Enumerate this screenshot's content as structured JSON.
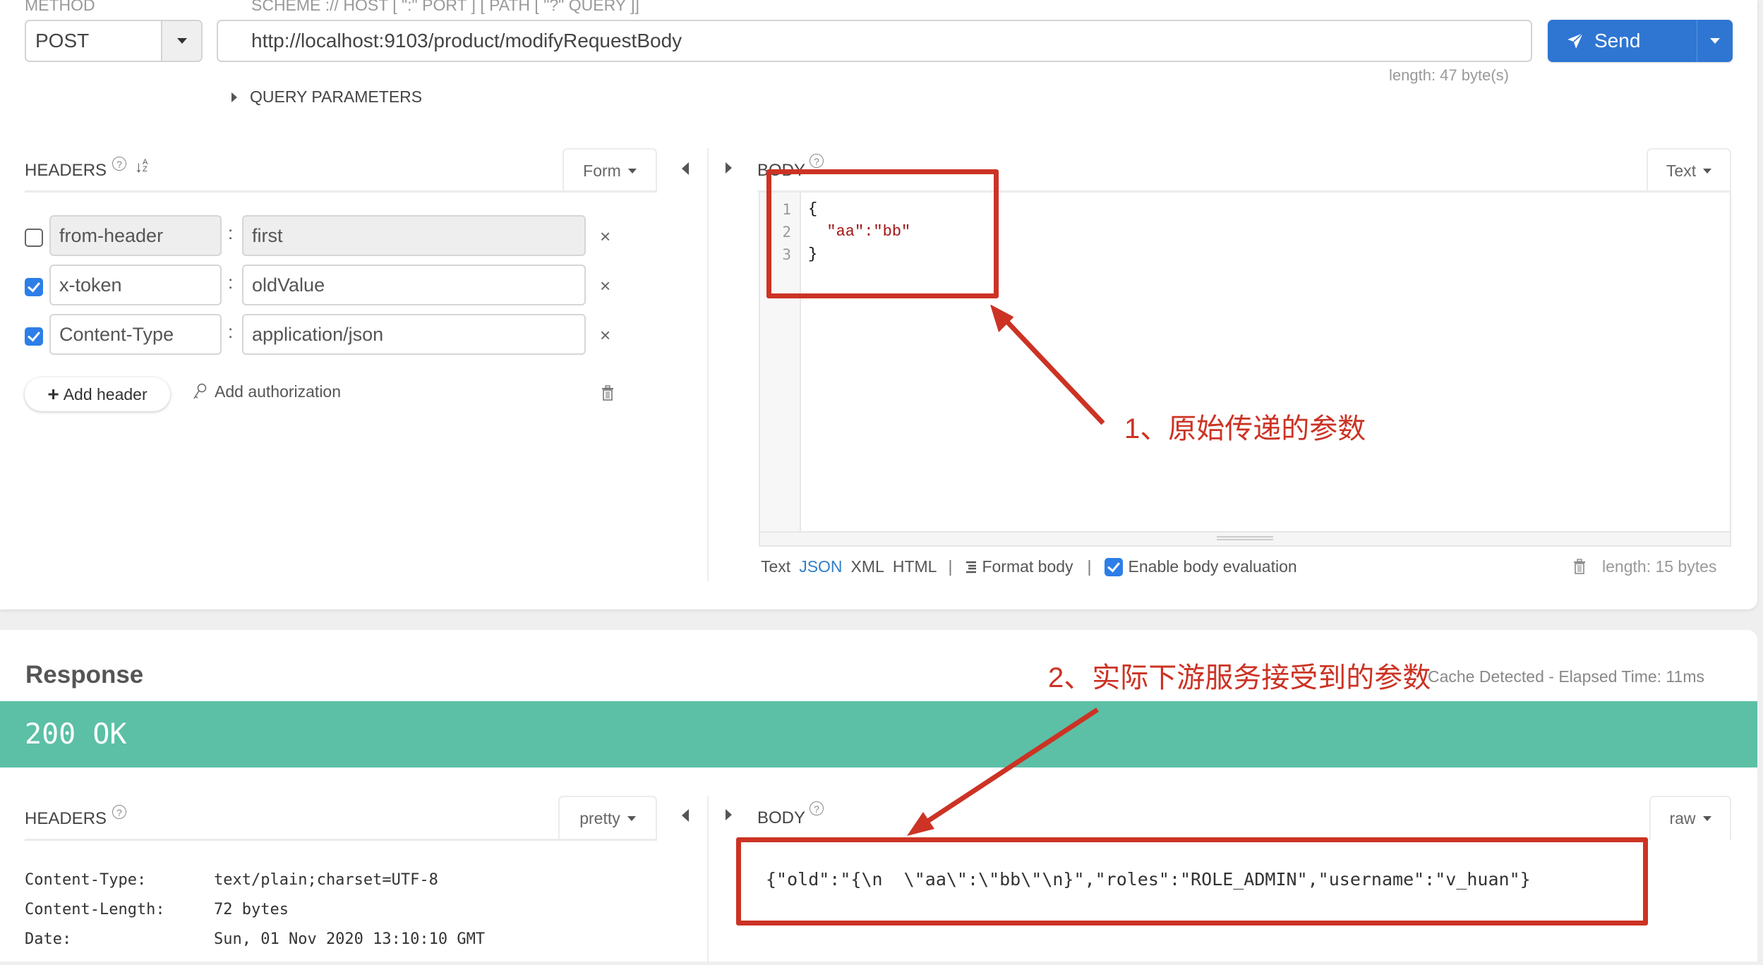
{
  "request": {
    "method_label": "METHOD",
    "method_value": "POST",
    "url_label": "SCHEME :// HOST [ \":\" PORT ] [ PATH [ \"?\" QUERY ]]",
    "url_value": "http://localhost:9103/product/modifyRequestBody",
    "url_length": "length: 47 byte(s)",
    "send_label": "Send",
    "query_params_label": "QUERY PARAMETERS",
    "headers": {
      "title": "HEADERS",
      "help": "?",
      "sort_icon": "sort-az-icon",
      "mode": "Form",
      "rows": [
        {
          "enabled": false,
          "key": "from-header",
          "value": "first"
        },
        {
          "enabled": true,
          "key": "x-token",
          "value": "oldValue"
        },
        {
          "enabled": true,
          "key": "Content-Type",
          "value": "application/json"
        }
      ],
      "separator": ":",
      "remove_icon": "×",
      "add_header_label": "Add header",
      "add_authorization_label": "Add authorization"
    },
    "body": {
      "title": "BODY",
      "help": "?",
      "mode": "Text",
      "lines": [
        {
          "num": "1",
          "text": "{"
        },
        {
          "num": "2",
          "text": "  \"aa\":\"bb\""
        },
        {
          "num": "3",
          "text": "}"
        }
      ],
      "formats": [
        "Text",
        "JSON",
        "XML",
        "HTML"
      ],
      "active_format": "JSON",
      "separator": "|",
      "format_body_label": "Format body",
      "enable_eval_label": "Enable body evaluation",
      "enable_eval_checked": true,
      "length": "length: 15 bytes"
    }
  },
  "response": {
    "title": "Response",
    "timing": "Cache Detected - Elapsed Time: 11ms",
    "status": "200 OK",
    "status_color": "#5bc0a6",
    "headers": {
      "title": "HEADERS",
      "help": "?",
      "mode": "pretty",
      "rows": [
        {
          "key": "Content-Type:",
          "value": "text/plain;charset=UTF-8"
        },
        {
          "key": "Content-Length:",
          "value": "72 bytes"
        },
        {
          "key": "Date:",
          "value": "Sun, 01 Nov 2020 13:10:10 GMT"
        }
      ]
    },
    "body": {
      "title": "BODY",
      "help": "?",
      "mode": "raw",
      "content": "{\"old\":\"{\\n  \\\"aa\\\":\\\"bb\\\"\\n}\",\"roles\":\"ROLE_ADMIN\",\"username\":\"v_huan\"}"
    }
  },
  "annotations": {
    "note1": "1、原始传递的参数",
    "note2": "2、实际下游服务接受到的参数",
    "color": "#cc3324"
  }
}
